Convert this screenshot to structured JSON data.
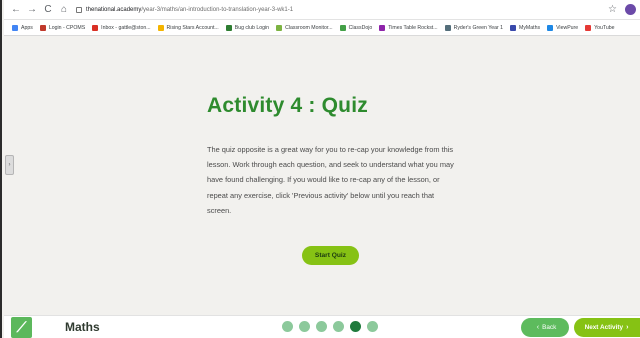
{
  "browser": {
    "nav": {
      "back": "←",
      "forward": "→",
      "reload": "C",
      "home": "⌂"
    },
    "url_domain": "thenational.academy",
    "url_path": "/year-3/maths/an-introduction-to-translation-year-3-wk1-1",
    "bookmarks": [
      {
        "label": "Apps",
        "color": "#4285f4"
      },
      {
        "label": "Login - CPOMS",
        "color": "#c0392b"
      },
      {
        "label": "Inbox - gattle@ston...",
        "color": "#d93025"
      },
      {
        "label": "Rising Stars Account...",
        "color": "#f4b400"
      },
      {
        "label": "Bug club Login",
        "color": "#2e7d32"
      },
      {
        "label": "Classroom Monitor...",
        "color": "#7cb342"
      },
      {
        "label": "ClassDojo",
        "color": "#43a047"
      },
      {
        "label": "Times Table Rockst...",
        "color": "#8e24aa"
      },
      {
        "label": "Ryder's Green Year 1",
        "color": "#546e7a"
      },
      {
        "label": "MyMaths",
        "color": "#3949ab"
      },
      {
        "label": "ViewPure",
        "color": "#1e88e5"
      },
      {
        "label": "YouTube",
        "color": "#e53935"
      }
    ]
  },
  "main": {
    "title": "Activity 4 : Quiz",
    "body": "The quiz opposite is a great way for you to re-cap your knowledge from this lesson. Work through each question, and seek to understand what you may have found challenging. If you would like to re-cap any of the lesson, or repeat any exercise, click 'Previous activity' below until you reach that screen.",
    "start_label": "Start Quiz"
  },
  "footer": {
    "subject": "Maths",
    "progress": {
      "total": 6,
      "current": 5
    },
    "back_label": "Back",
    "next_label": "Next Activity"
  },
  "colors": {
    "accent": "#86c214",
    "title": "#2e8b2e",
    "dot": "#8cc99b",
    "dot_active": "#1f7a3c"
  }
}
